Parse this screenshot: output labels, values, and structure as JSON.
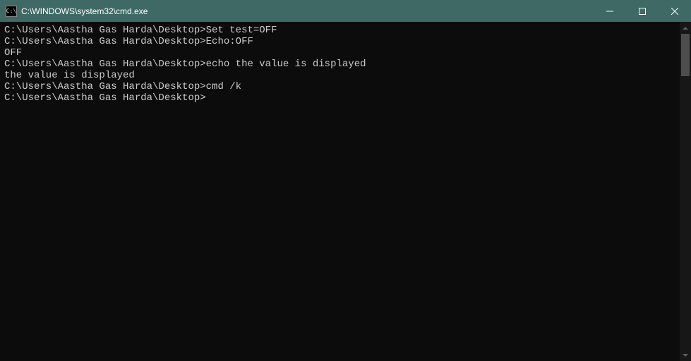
{
  "window": {
    "title": "C:\\WINDOWS\\system32\\cmd.exe",
    "icon_text": "C:\\"
  },
  "terminal": {
    "lines": [
      {
        "prompt": "C:\\Users\\Aastha Gas Harda\\Desktop>",
        "command": "Set test=OFF"
      },
      {
        "output": ""
      },
      {
        "prompt": "C:\\Users\\Aastha Gas Harda\\Desktop>",
        "command": "Echo:OFF"
      },
      {
        "output": "OFF"
      },
      {
        "output": ""
      },
      {
        "prompt": "C:\\Users\\Aastha Gas Harda\\Desktop>",
        "command": "echo the value is displayed"
      },
      {
        "output": "the value is displayed"
      },
      {
        "output": ""
      },
      {
        "prompt": "C:\\Users\\Aastha Gas Harda\\Desktop>",
        "command": "cmd /k"
      },
      {
        "prompt": "C:\\Users\\Aastha Gas Harda\\Desktop>",
        "command": ""
      }
    ]
  }
}
